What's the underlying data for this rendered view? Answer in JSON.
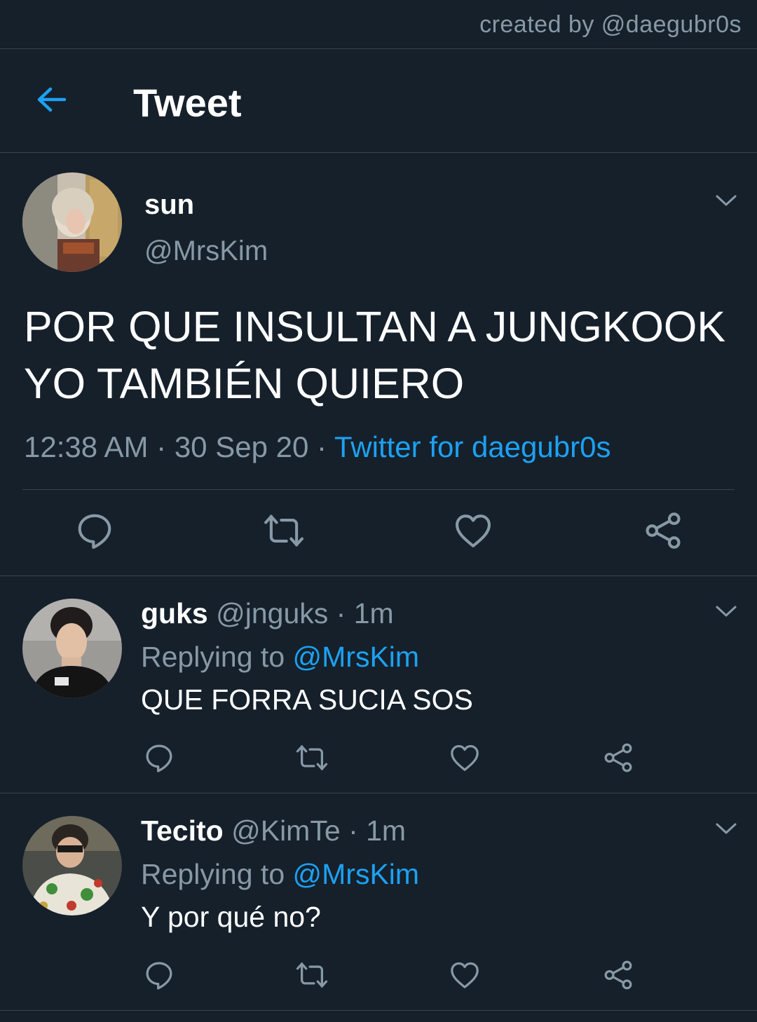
{
  "credit": "created by @daegubr0s",
  "header": {
    "title": "Tweet",
    "back_icon": "arrow-left-icon"
  },
  "colors": {
    "background": "#15202b",
    "accent": "#1da1f2",
    "muted": "#8899a6",
    "divider": "#38444d"
  },
  "main_tweet": {
    "name": "sun",
    "handle": "@MrsKim",
    "text": "POR QUE INSULTAN A JUNGKOOK YO TAMBIÉN QUIERO",
    "time": "12:38 AM",
    "sep1": "·",
    "date": "30 Sep 20",
    "sep2": "·",
    "source": "Twitter for daegubr0s",
    "actions": [
      "reply-icon",
      "retweet-icon",
      "like-icon",
      "share-icon"
    ]
  },
  "replies": [
    {
      "name": "guks",
      "handle": "@jnguks",
      "time_sep": "·",
      "time": "1m",
      "replying_label": "Replying to",
      "replying_to": "@MrsKim",
      "text": "QUE FORRA SUCIA SOS"
    },
    {
      "name": "Tecito",
      "handle": "@KimTe",
      "time_sep": "·",
      "time": "1m",
      "replying_label": "Replying to",
      "replying_to": "@MrsKim",
      "text": "Y por qué no?"
    }
  ]
}
